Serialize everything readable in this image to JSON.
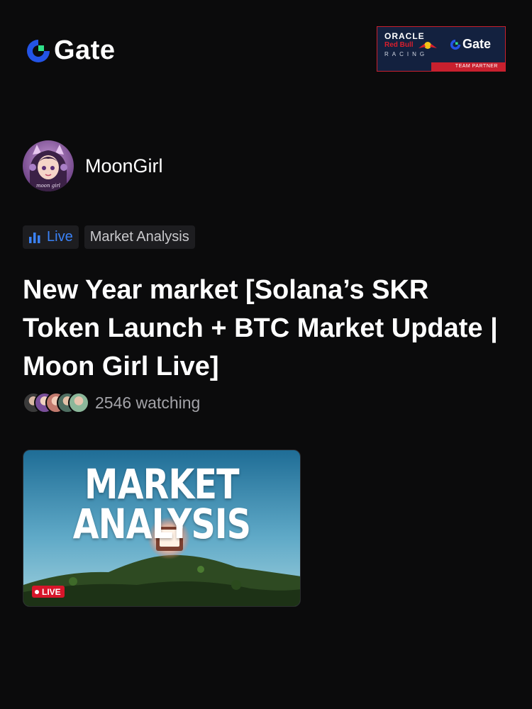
{
  "brand": {
    "name": "Gate",
    "logo_icon": "gate-logo-icon"
  },
  "partner_banner": {
    "oracle": "ORACLE",
    "redbull": "Red Bull",
    "racing": "RACING",
    "gate": "Gate",
    "tagline": "TEAM PARTNER"
  },
  "host": {
    "name": "MoonGirl",
    "avatar_caption": "moon girl"
  },
  "tags": {
    "live": "Live",
    "category": "Market Analysis"
  },
  "stream": {
    "title": "New Year market [Solana’s SKR Token Launch + BTC Market Update | Moon Girl Live]",
    "watching": "2546 watching"
  },
  "thumbnail": {
    "headline_line1": "MARKET",
    "headline_line2": "ANALYSIS",
    "badge": "LIVE"
  },
  "colors": {
    "background": "#0b0b0c",
    "accent_blue": "#3b82f6",
    "live_red": "#d7162a",
    "gate_green": "#2fe08a"
  }
}
